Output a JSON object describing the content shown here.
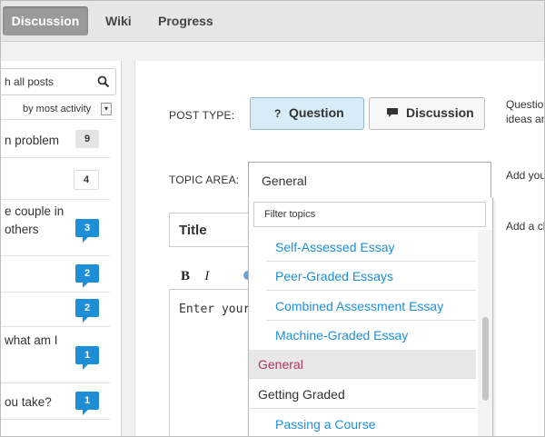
{
  "nav": {
    "tabs": [
      {
        "label": "Discussion",
        "active": true
      },
      {
        "label": "Wiki",
        "active": false
      },
      {
        "label": "Progress",
        "active": false
      }
    ]
  },
  "sidebar": {
    "search_text": "h all posts",
    "sort_label": "by most activity",
    "posts": [
      {
        "lines": [
          "n problem"
        ],
        "count": "9",
        "style": "gray"
      },
      {
        "lines": [
          ""
        ],
        "count": "4",
        "style": "white"
      },
      {
        "lines": [
          "e couple in",
          "others"
        ],
        "count": "3",
        "style": "blue"
      },
      {
        "lines": [
          ""
        ],
        "count": "2",
        "style": "blue"
      },
      {
        "lines": [
          ""
        ],
        "count": "2",
        "style": "blue"
      },
      {
        "lines": [
          "what am I"
        ],
        "count": "1",
        "style": "blue"
      },
      {
        "lines": [
          "ou take?"
        ],
        "count": "1",
        "style": "blue"
      }
    ]
  },
  "form": {
    "post_type_label": "POST TYPE:",
    "question_label": "Question",
    "discussion_label": "Discussion",
    "type_note_line1": "Question",
    "type_note_line2": "ideas an",
    "topic_area_label": "TOPIC AREA:",
    "topic_selected": "General",
    "topic_note": "Add you",
    "title_placeholder": "Title",
    "title_note": "Add a cl",
    "bold_label": "B",
    "italic_label": "I",
    "editor_placeholder": "Enter your"
  },
  "dropdown": {
    "filter_placeholder": "Filter topics",
    "items": [
      {
        "label": "Self-Assessed Essay",
        "kind": "sub"
      },
      {
        "label": "Peer-Graded Essays",
        "kind": "sub"
      },
      {
        "label": "Combined Assessment Essay",
        "kind": "sub"
      },
      {
        "label": "Machine-Graded Essay",
        "kind": "sub"
      },
      {
        "label": "General",
        "kind": "highlighted"
      },
      {
        "label": "Getting Graded",
        "kind": "top"
      },
      {
        "label": "Passing a Course",
        "kind": "sub"
      }
    ]
  },
  "colors": {
    "accent_blue": "#1e8fd6",
    "selected_topic": "#b2355b",
    "active_tab_bg": "#9a9a9a"
  }
}
